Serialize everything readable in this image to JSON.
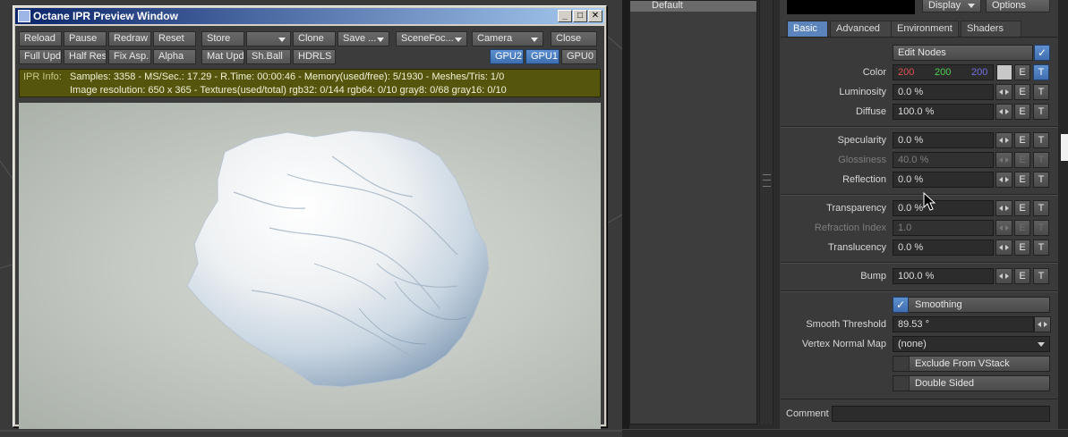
{
  "ipr_window": {
    "title": "Octane IPR Preview Window",
    "title_buttons": [
      "_",
      "□",
      "✕"
    ],
    "toolbar_row1": [
      "Reload",
      "Pause",
      "Redraw",
      "Reset",
      "Store",
      "",
      "Clone",
      "Save ...",
      "SceneFoc...",
      "Camera",
      "Close"
    ],
    "toolbar_row2": [
      "Full Upd.",
      "Half Res",
      "Fix Asp.",
      "Alpha",
      "Mat Upd",
      "Sh.Ball",
      "HDRLS"
    ],
    "gpu_buttons": [
      "GPU2",
      "GPU1",
      "GPU0"
    ],
    "info": {
      "label": "IPR Info:",
      "line1": "Samples: 3358  -  MS/Sec.: 17.29  -  R.Time: 00:00:46 - Memory(used/free): 5/1930  -  Meshes/Tris: 1/0",
      "line2": "Image resolution: 650 x 365 - Textures(used/total) rgb32: 0/144   rgb64: 0/10   gray8: 0/68   gray16: 0/10"
    }
  },
  "surface_list": {
    "items": [
      "Default"
    ]
  },
  "top_buttons": {
    "display": "Display",
    "options": "Options"
  },
  "tabs": [
    "Basic",
    "Advanced",
    "Environment",
    "Shaders"
  ],
  "edit_nodes": "Edit Nodes",
  "color": {
    "label": "Color",
    "r": "200",
    "g": "200",
    "b": "200",
    "r_color": "#e05050",
    "g_color": "#50d050",
    "b_color": "#7070e0"
  },
  "props": [
    {
      "label": "Luminosity",
      "value": "0.0 %"
    },
    {
      "label": "Diffuse",
      "value": "100.0 %"
    },
    {
      "label": "Specularity",
      "value": "0.0 %"
    },
    {
      "label": "Glossiness",
      "value": "40.0 %"
    },
    {
      "label": "Reflection",
      "value": "0.0 %"
    },
    {
      "label": "Transparency",
      "value": "0.0 %"
    },
    {
      "label": "Refraction Index",
      "value": "1.0"
    },
    {
      "label": "Translucency",
      "value": "0.0 %"
    },
    {
      "label": "Bump",
      "value": "100.0 %"
    }
  ],
  "env_letters": {
    "e": "E",
    "t": "T"
  },
  "smoothing": "Smoothing",
  "smooth_threshold": {
    "label": "Smooth Threshold",
    "value": "89.53 °"
  },
  "vertex_normal_map": {
    "label": "Vertex Normal Map",
    "value": "(none)"
  },
  "exclude_vstack": "Exclude From VStack",
  "double_sided": "Double Sided",
  "comment": {
    "label": "Comment",
    "value": ""
  }
}
